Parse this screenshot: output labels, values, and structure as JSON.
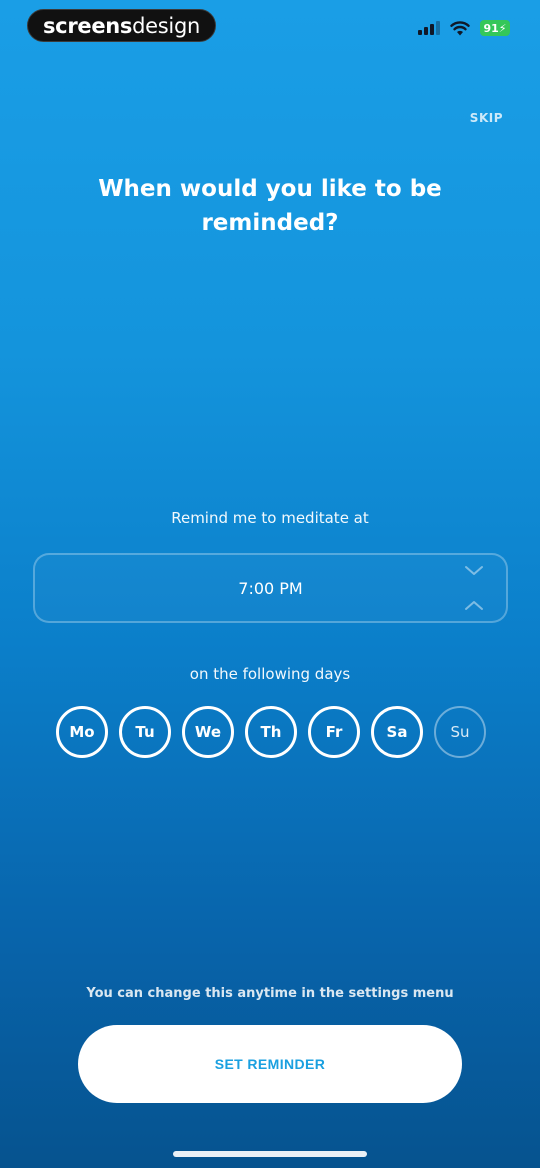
{
  "status_bar": {
    "brand_bold": "screens",
    "brand_light": "design",
    "battery": "91"
  },
  "header": {
    "skip_label": "SKIP"
  },
  "title": "When would you like to be reminded?",
  "reminder": {
    "label": "Remind me to meditate at",
    "time": "7:00 PM"
  },
  "days": {
    "label": "on the following days",
    "items": [
      {
        "label": "Mo",
        "selected": true
      },
      {
        "label": "Tu",
        "selected": true
      },
      {
        "label": "We",
        "selected": true
      },
      {
        "label": "Th",
        "selected": true
      },
      {
        "label": "Fr",
        "selected": true
      },
      {
        "label": "Sa",
        "selected": true
      },
      {
        "label": "Su",
        "selected": false
      }
    ]
  },
  "footer": {
    "note": "You can change this anytime in the settings menu",
    "button_label": "SET REMINDER"
  },
  "colors": {
    "accent": "#1aa0e0",
    "battery": "#34c759"
  },
  "icons": [
    "cellular-signal-icon",
    "wifi-icon",
    "battery-icon",
    "chevron-down-icon",
    "chevron-up-icon"
  ]
}
